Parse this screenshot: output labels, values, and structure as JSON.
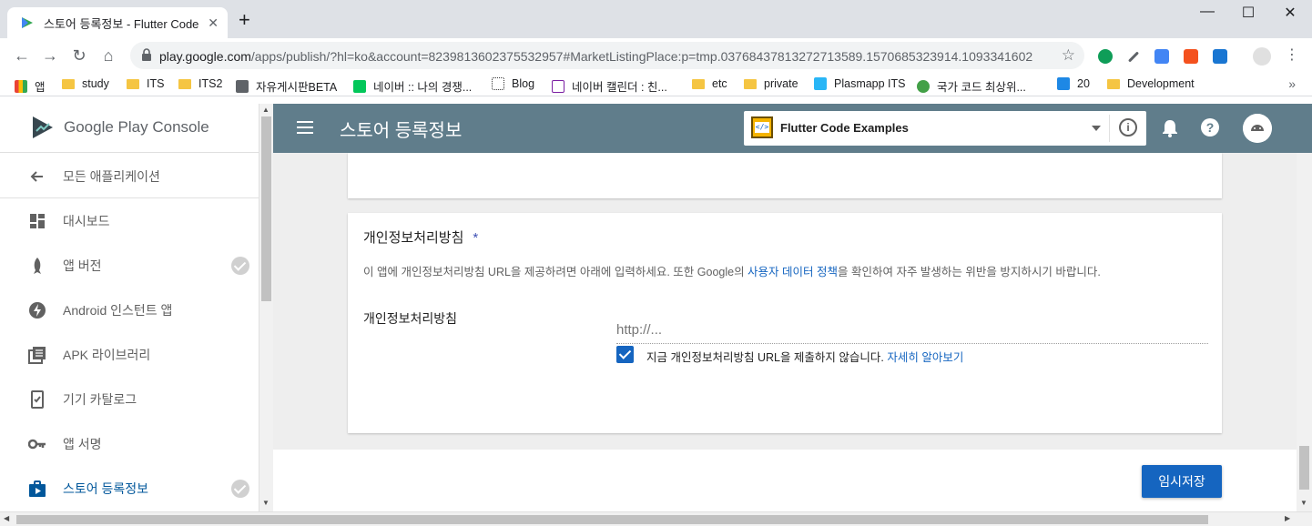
{
  "browser": {
    "tab_title": "스토어 등록정보 - Flutter Code",
    "tab_close": "✕",
    "new_tab": "+",
    "url_host": "play.google.com",
    "url_path": "/apps/publish/?hl=ko&account=8239813602375532957#MarketListingPlace:p=tmp.03768437813272713589.1570685323914.1093341602",
    "bookmarks": [
      "앱",
      "study",
      "ITS",
      "ITS2",
      "자유게시판BETA",
      "네이버 :: 나의 경쟁...",
      "Blog",
      "네이버 캘린더 : 친...",
      "etc",
      "private",
      "Plasmapp ITS",
      "국가 코드 최상위...",
      "20",
      "Development"
    ],
    "bookmarks_more": "»"
  },
  "sidebar": {
    "brand": "Google Play Console",
    "back_label": "모든 애플리케이션",
    "items": [
      {
        "label": "대시보드"
      },
      {
        "label": "앱 버전"
      },
      {
        "label": "Android 인스턴트 앱"
      },
      {
        "label": "APK 라이브러리"
      },
      {
        "label": "기기 카탈로그"
      },
      {
        "label": "앱 서명"
      },
      {
        "label": "스토어 등록정보"
      }
    ]
  },
  "header": {
    "title": "스토어 등록정보",
    "app_name": "Flutter Code Examples",
    "app_icon_text": "</>",
    "info": "i",
    "help": "?"
  },
  "privacy_card": {
    "title": "개인정보처리방침",
    "required_mark": "*",
    "desc_before": "이 앱에 개인정보처리방침 URL을 제공하려면 아래에 입력하세요. 또한 Google의 ",
    "desc_link": "사용자 데이터 정책",
    "desc_after": "을 확인하여 자주 발생하는 위반을 방지하시기 바랍니다.",
    "field_label": "개인정보처리방침",
    "placeholder": "http://...",
    "checkbox_label": "지금 개인정보처리방침 URL을 제출하지 않습니다. ",
    "checkbox_link": "자세히 알아보기",
    "checkbox_checked": true
  },
  "footer": {
    "save_label": "임시저장"
  },
  "colors": {
    "appbar": "#607d8b",
    "primary": "#1565c0",
    "active_nav": "#01579b"
  }
}
